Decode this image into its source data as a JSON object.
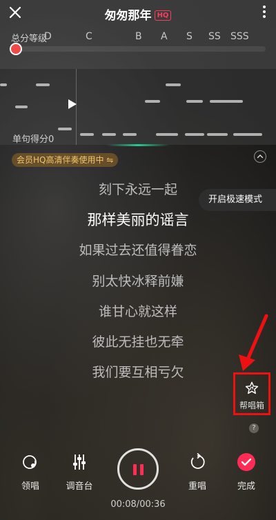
{
  "header": {
    "title": "匆匆那年",
    "badge": "HQ"
  },
  "score": {
    "label": "总分等级",
    "grades": [
      "D",
      "C",
      "B",
      "A",
      "S",
      "SS",
      "SSS"
    ],
    "progress": 0
  },
  "pitch": {
    "line_score_label": "单句得分",
    "line_score_value": "0"
  },
  "member_pill": "会员HQ高清伴奏使用中 ⇋",
  "lyrics": [
    {
      "text": "刻下永远一起",
      "current": false
    },
    {
      "text": "那样美丽的谣言",
      "current": true
    },
    {
      "text": "如果过去还值得眷恋",
      "current": false
    },
    {
      "text": "别太快冰释前嫌",
      "current": false
    },
    {
      "text": "谁甘心就这样",
      "current": false
    },
    {
      "text": "彼此无挂也无牵",
      "current": false
    },
    {
      "text": "我们要互相亏欠",
      "current": false
    }
  ],
  "speed_mode_label": "开启极速模式",
  "help_box": {
    "label": "帮唱箱",
    "help": "?"
  },
  "controls": {
    "lead_label": "领唱",
    "tuner_label": "调音台",
    "restart_label": "重唱",
    "done_label": "完成"
  },
  "time": "00:08/00:36",
  "colors": {
    "accent": "#ff2d55",
    "highlight": "#e11111",
    "member_text": "#f1c46b"
  }
}
